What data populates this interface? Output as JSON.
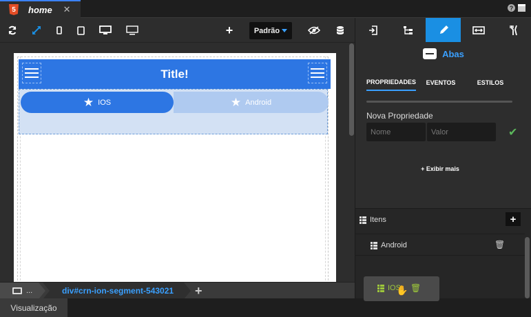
{
  "file_tab": {
    "label": "home",
    "icon_text": "5"
  },
  "window_controls": {
    "help": "?"
  },
  "toolbar": {
    "preset_label": "Padrão",
    "buttons": [
      "refresh-icon",
      "fit-icon",
      "phone-small-icon",
      "tablet-icon",
      "desktop-icon",
      "monitor-icon",
      "add-icon",
      "eye-icon",
      "database-icon"
    ],
    "add_label": "+"
  },
  "app": {
    "title": "Title!",
    "segments": [
      {
        "label": "IOS",
        "icon": "star-icon",
        "active": true
      },
      {
        "label": "Android",
        "icon": "star-icon",
        "active": false
      }
    ]
  },
  "breadcrumb": {
    "root_label": "...",
    "current": "div#crn-ion-segment-543021",
    "add_label": "+"
  },
  "bottom_tab": {
    "label": "Visualização"
  },
  "right_panel": {
    "tabs": [
      "export-icon",
      "tree-icon",
      "pencil-icon",
      "resize-icon",
      "tools-icon"
    ],
    "active_tab": "pencil-icon",
    "widget_name": "Abas",
    "subtabs": [
      "PROPRIEDADES",
      "EVENTOS",
      "ESTILOS"
    ],
    "active_subtab": "PROPRIEDADES",
    "new_prop_label": "Nova Propriedade",
    "name_placeholder": "Nome",
    "value_placeholder": "Valor",
    "show_more": "+ Exibir mais",
    "items_title": "Itens",
    "add_item": "+",
    "items": [
      {
        "label": "Android"
      }
    ],
    "dragging_item": {
      "label": "IOS"
    }
  },
  "colors": {
    "accent": "#1a8fe3",
    "header_blue": "#2d76e3",
    "link_blue": "#3aa0ff",
    "confirm_green": "#5cb85c",
    "drag_green": "#9dc73b"
  }
}
